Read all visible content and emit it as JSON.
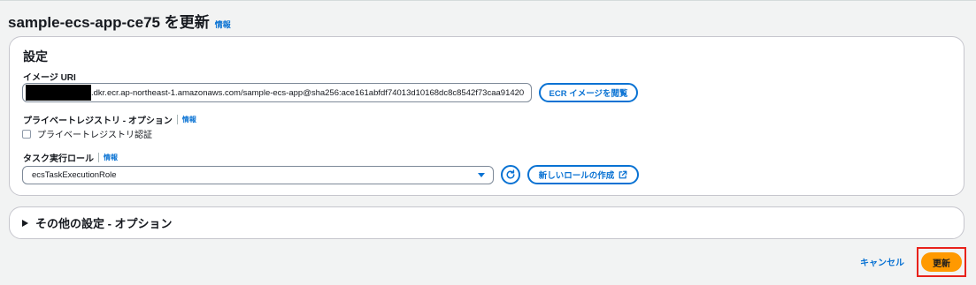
{
  "page": {
    "title": "sample-ecs-app-ce75 を更新",
    "info": "情報"
  },
  "settings": {
    "title": "設定",
    "image_uri": {
      "label": "イメージ URI",
      "value": ".dkr.ecr.ap-northeast-1.amazonaws.com/sample-ecs-app@sha256:ace161abfdf74013d10168dc8c8542f73caa91420",
      "browse_button": "ECR イメージを閲覧"
    },
    "private_registry": {
      "label": "プライベートレジストリ - オプション",
      "info": "情報",
      "checkbox_label": "プライベートレジストリ認証",
      "checked": false
    },
    "task_role": {
      "label": "タスク実行ロール",
      "info": "情報",
      "selected": "ecsTaskExecutionRole",
      "create_button": "新しいロールの作成"
    }
  },
  "other_settings": {
    "title": "その他の設定 - オプション"
  },
  "footer": {
    "cancel": "キャンセル",
    "update": "更新"
  },
  "colors": {
    "link": "#0972d3",
    "primary": "#ff9900",
    "highlight": "#e8221b"
  }
}
